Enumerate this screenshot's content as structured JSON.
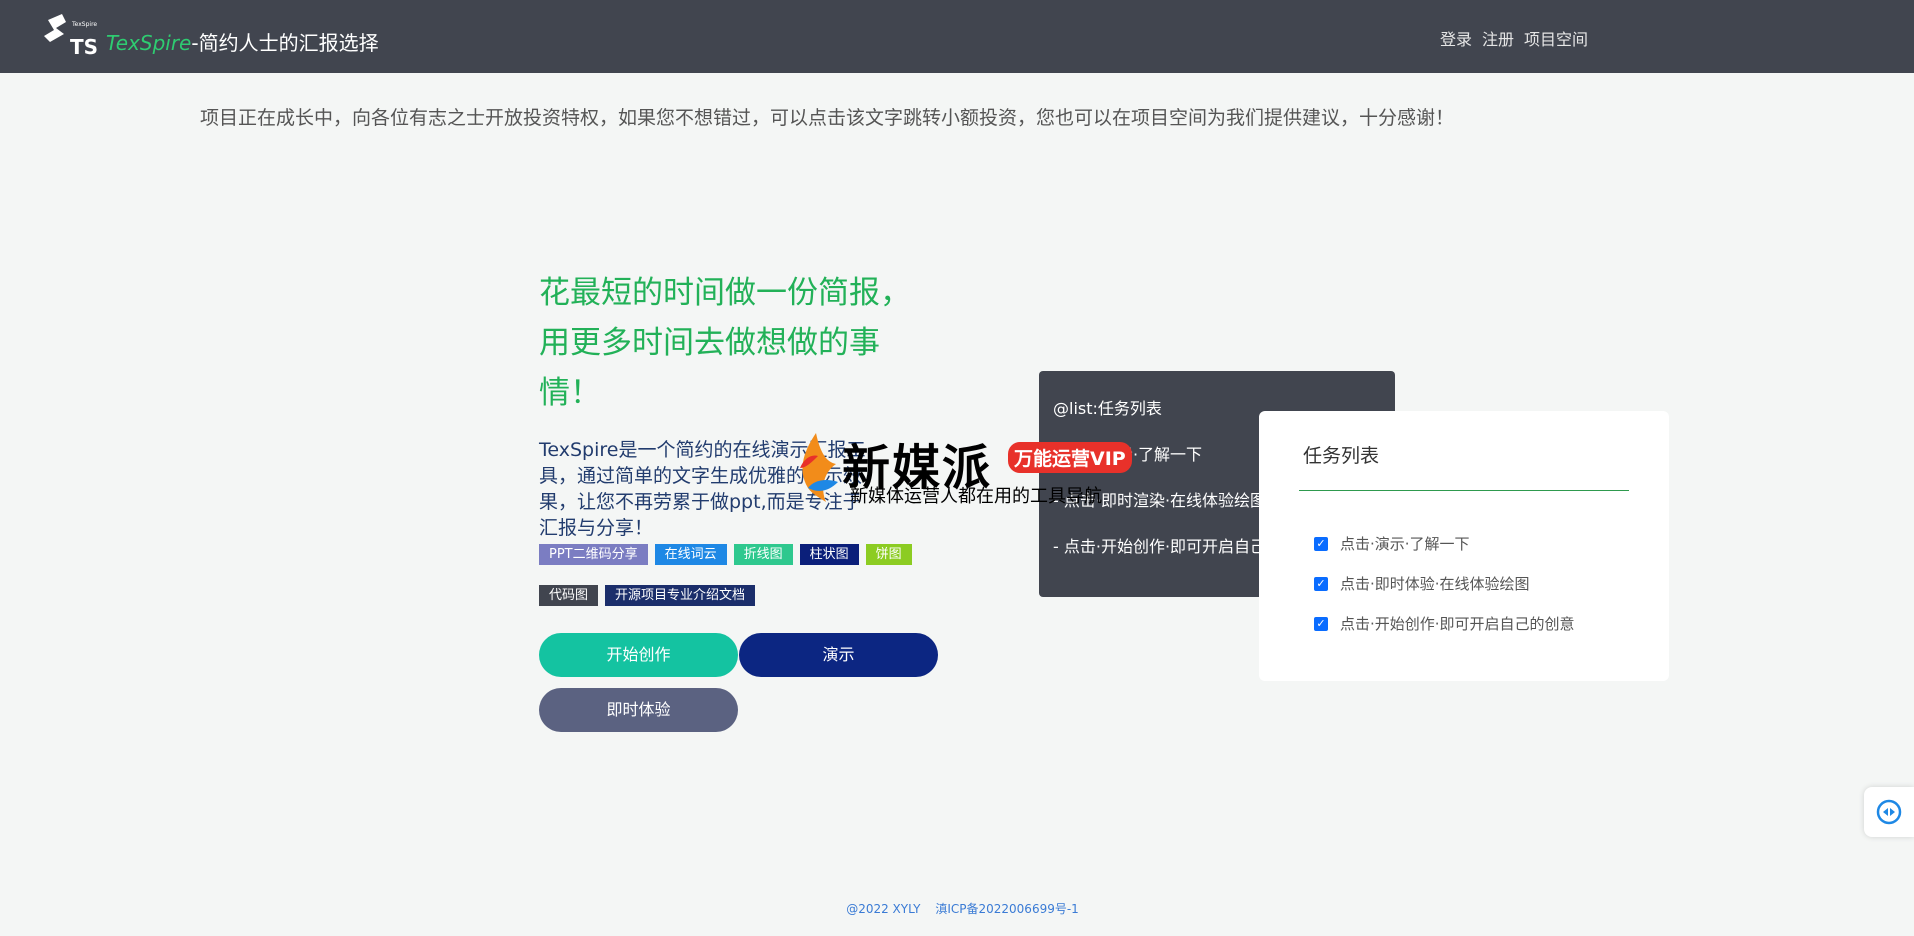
{
  "header": {
    "brand_prefix": "TexSpire",
    "brand_suffix": "-简约人士的汇报选择",
    "nav": [
      "登录",
      "注册",
      "项目空间"
    ]
  },
  "notice": "项目正在成长中，向各位有志之士开放投资特权，如果您不想错过，可以点击该文字跳转小额投资，您也可以在项目空间为我们提供建议，十分感谢！",
  "hero": {
    "title": "花最短的时间做一份简报，用更多时间去做想做的事情！",
    "description": "TexSpire是一个简约的在线演示汇报工具，通过简单的文字生成优雅的演示效果，让您不再劳累于做ppt,而是专注于汇报与分享！"
  },
  "tags_row1": [
    {
      "label": "PPT二维码分享",
      "color": "#7b7dc2"
    },
    {
      "label": "在线词云",
      "color": "#1e88e5"
    },
    {
      "label": "折线图",
      "color": "#2ec88e"
    },
    {
      "label": "柱状图",
      "color": "#0b1f7a"
    },
    {
      "label": "饼图",
      "color": "#8ccc22"
    }
  ],
  "tags_row2": [
    {
      "label": "代码图",
      "color": "#41454f"
    },
    {
      "label": "开源项目专业介绍文档",
      "color": "#1b2e6b"
    }
  ],
  "buttons": {
    "start": "开始创作",
    "demo": "演示",
    "try": "即时体验"
  },
  "code_card": {
    "lines": [
      "@list:任务列表",
      "- 点击·演示·了解一下",
      "- 点击·即时渲染·在线体验绘图",
      "- 点击·开始创作·即可开启自己的创意"
    ]
  },
  "task_card": {
    "title": "任务列表",
    "items": [
      "点击·演示·了解一下",
      "点击·即时体验·在线体验绘图",
      "点击·开始创作·即可开启自己的创意"
    ]
  },
  "watermark": {
    "main": "新媒派",
    "badge": "万能运营VIP",
    "sub": "新媒体运营人都在用的工具导航"
  },
  "footer": {
    "copyright": "@2022 XYLY",
    "icp": "滇ICP备2022006699号-1"
  }
}
